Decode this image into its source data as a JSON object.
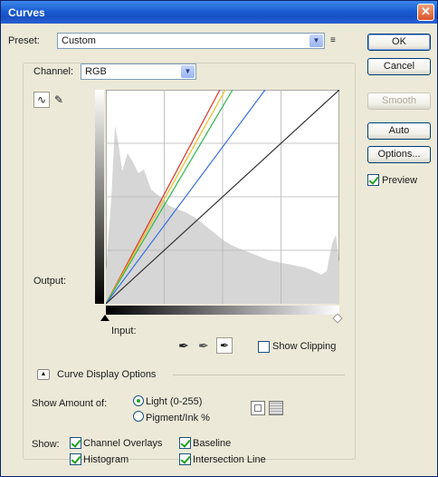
{
  "window": {
    "title": "Curves",
    "close_glyph": "✕"
  },
  "preset": {
    "label": "Preset:",
    "value": "Custom",
    "menu_icon": "≡"
  },
  "channel": {
    "label": "Channel:",
    "value": "RGB"
  },
  "buttons": {
    "ok": "OK",
    "cancel": "Cancel",
    "smooth": "Smooth",
    "auto": "Auto",
    "options": "Options..."
  },
  "preview": {
    "label": "Preview",
    "checked": true
  },
  "graph": {
    "output_label": "Output:",
    "input_label": "Input:",
    "show_clipping": "Show Clipping"
  },
  "display_options": {
    "title": "Curve Display Options",
    "show_amount_label": "Show Amount of:",
    "light": "Light  (0-255)",
    "pigment": "Pigment/Ink %",
    "show_label": "Show:",
    "channel_overlays": "Channel Overlays",
    "baseline": "Baseline",
    "histogram": "Histogram",
    "intersection_line": "Intersection Line"
  },
  "colors": {
    "titlebar": "#1a5dd3",
    "red_curve": "#e0302a",
    "green_curve": "#2fb84a",
    "blue_curve": "#3a6fe0",
    "yellow_curve": "#e8c020",
    "histogram": "#d8d8d8"
  }
}
